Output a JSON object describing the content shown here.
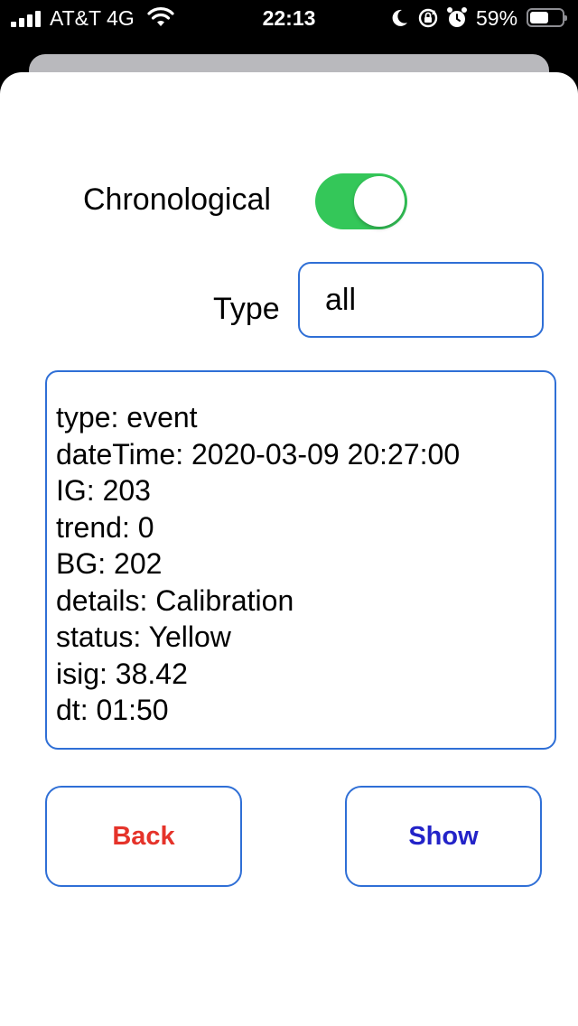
{
  "status_bar": {
    "carrier": "AT&T 4G",
    "time": "22:13",
    "battery_percent": "59%",
    "battery_level": 0.59,
    "icons": [
      "signal-bars-icon",
      "wifi-icon",
      "moon-icon",
      "rotation-lock-icon",
      "alarm-icon",
      "battery-icon"
    ]
  },
  "form": {
    "chronological_label": "Chronological",
    "chronological_on": true,
    "type_label": "Type",
    "type_value": "all"
  },
  "details": [
    "type: event",
    "dateTime: 2020-03-09 20:27:00",
    "IG: 203",
    "trend: 0",
    "BG: 202",
    "details: Calibration",
    "status: Yellow",
    "isig: 38.42",
    "dt: 01:50"
  ],
  "buttons": {
    "back_label": "Back",
    "show_label": "Show"
  },
  "colors": {
    "toggle_on": "#34c759",
    "border_accent": "#2f6fd6",
    "back_text": "#e5332a",
    "show_text": "#2323c8"
  }
}
